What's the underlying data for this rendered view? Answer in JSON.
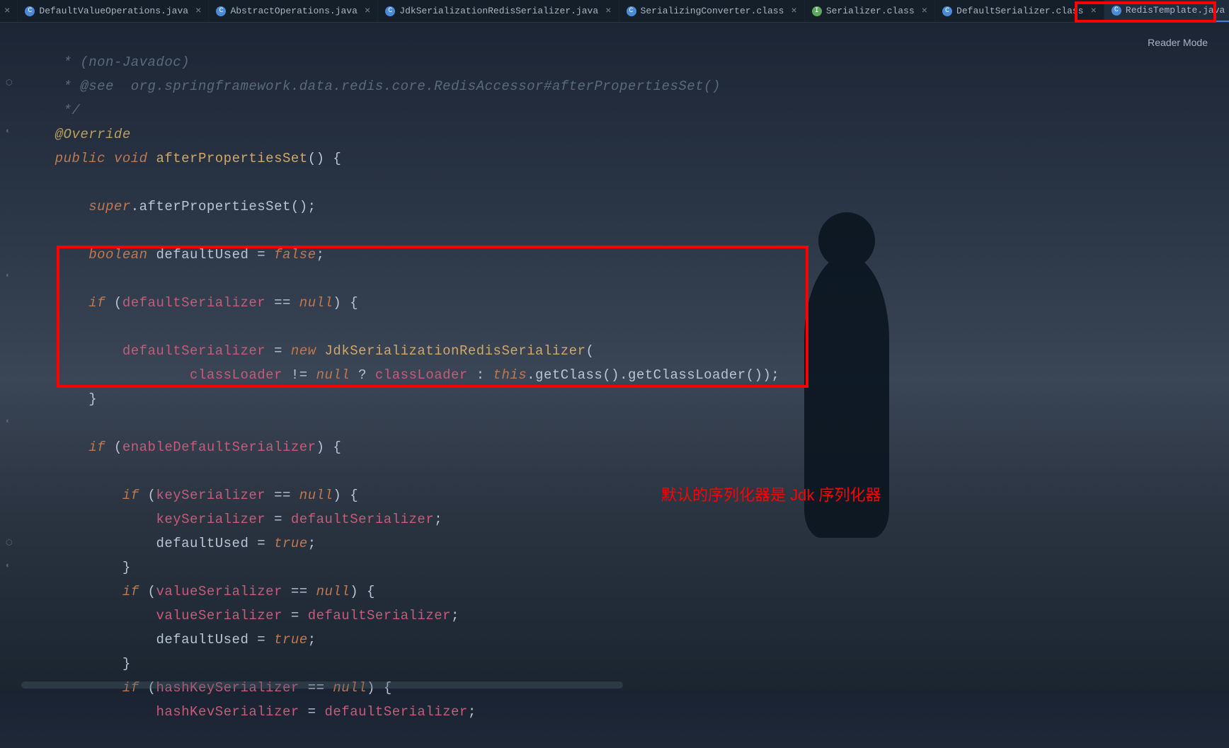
{
  "tabs": [
    {
      "label": "DefaultValueOperations.java",
      "iconClass": "blue",
      "iconChar": "C"
    },
    {
      "label": "AbstractOperations.java",
      "iconClass": "blue",
      "iconChar": "C"
    },
    {
      "label": "JdkSerializationRedisSerializer.java",
      "iconClass": "blue",
      "iconChar": "C"
    },
    {
      "label": "SerializingConverter.class",
      "iconClass": "blue",
      "iconChar": "C"
    },
    {
      "label": "Serializer.class",
      "iconClass": "green",
      "iconChar": "I"
    },
    {
      "label": "DefaultSerializer.class",
      "iconClass": "blue",
      "iconChar": "C"
    },
    {
      "label": "RedisTemplate.java",
      "iconClass": "blue",
      "iconChar": "C",
      "active": true
    }
  ],
  "readerMode": "Reader Mode",
  "annotation": "默认的序列化器是 Jdk 序列化器",
  "code": {
    "l1": " * (non-Javadoc)",
    "l2": " * @see  org.springframework.data.redis.core.RedisAccessor#afterPropertiesSet()",
    "l3": " */",
    "l4_ann": "@Override",
    "l5_kw1": "public",
    "l5_kw2": "void",
    "l5_m": "afterPropertiesSet",
    "l5_p": "() {",
    "l7_kw": "super",
    "l7_m": ".afterPropertiesSet();",
    "l9_kw": "boolean",
    "l9_v": " defaultUsed = ",
    "l9_kw2": "false",
    "l9_e": ";",
    "l11_kw": "if",
    "l11_p1": " (",
    "l11_f": "defaultSerializer",
    "l11_op": " == ",
    "l11_kw2": "null",
    "l11_p2": ") {",
    "l13_f": "defaultSerializer",
    "l13_op": " = ",
    "l13_kw": "new",
    "l13_c": " JdkSerializationRedisSerializer",
    "l13_p": "(",
    "l14_f1": "classLoader",
    "l14_op1": " != ",
    "l14_kw1": "null",
    "l14_op2": " ? ",
    "l14_f2": "classLoader",
    "l14_op3": " : ",
    "l14_kw2": "this",
    "l14_m1": ".getClass().getClassLoader());",
    "l15_b": "}",
    "l17_kw": "if",
    "l17_p1": " (",
    "l17_f": "enableDefaultSerializer",
    "l17_p2": ") {",
    "l19_kw": "if",
    "l19_p1": " (",
    "l19_f": "keySerializer",
    "l19_op": " == ",
    "l19_kw2": "null",
    "l19_p2": ") {",
    "l20_f1": "keySerializer",
    "l20_op": " = ",
    "l20_f2": "defaultSerializer",
    "l20_e": ";",
    "l21_v": "defaultUsed = ",
    "l21_kw": "true",
    "l21_e": ";",
    "l22_b": "}",
    "l23_kw": "if",
    "l23_p1": " (",
    "l23_f": "valueSerializer",
    "l23_op": " == ",
    "l23_kw2": "null",
    "l23_p2": ") {",
    "l24_f1": "valueSerializer",
    "l24_op": " = ",
    "l24_f2": "defaultSerializer",
    "l24_e": ";",
    "l25_v": "defaultUsed = ",
    "l25_kw": "true",
    "l25_e": ";",
    "l26_b": "}",
    "l27_kw": "if",
    "l27_p1": " (",
    "l27_f": "hashKeySerializer",
    "l27_op": " == ",
    "l27_kw2": "null",
    "l27_p2": ") {",
    "l28_f1": "hashKevSerializer",
    "l28_op": " = ",
    "l28_f2": "defaultSerializer",
    "l28_e": ";"
  }
}
